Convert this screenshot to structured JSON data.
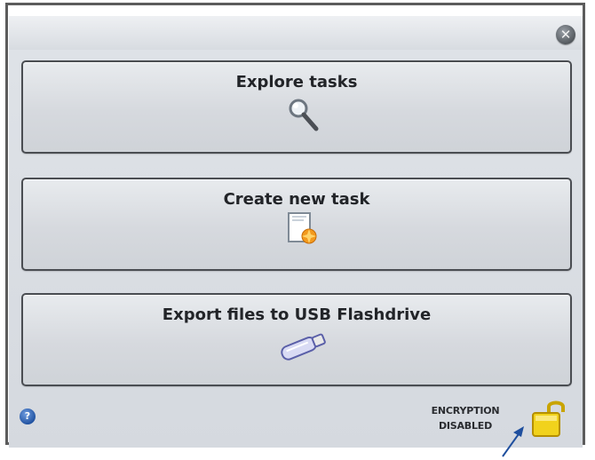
{
  "dialog": {
    "close_icon": "close-icon",
    "buttons": [
      {
        "label": "Explore tasks",
        "icon": "magnifier-icon"
      },
      {
        "label": "Create new task",
        "icon": "new-document-icon"
      },
      {
        "label": "Export files to USB Flashdrive",
        "icon": "usb-flashdrive-icon"
      }
    ],
    "footer": {
      "help_icon": "help-icon",
      "encryption_line1": "ENCRYPTION",
      "encryption_line2": "DISABLED",
      "lock_icon": "unlocked-padlock-icon"
    }
  },
  "colors": {
    "panel_bg": "#d8dce1",
    "button_border": "#4a4d52",
    "label_text": "#222428",
    "help_blue": "#1d4f9e",
    "lock_yellow": "#f1d21c",
    "annotation_arrow": "#1f4f9e"
  }
}
